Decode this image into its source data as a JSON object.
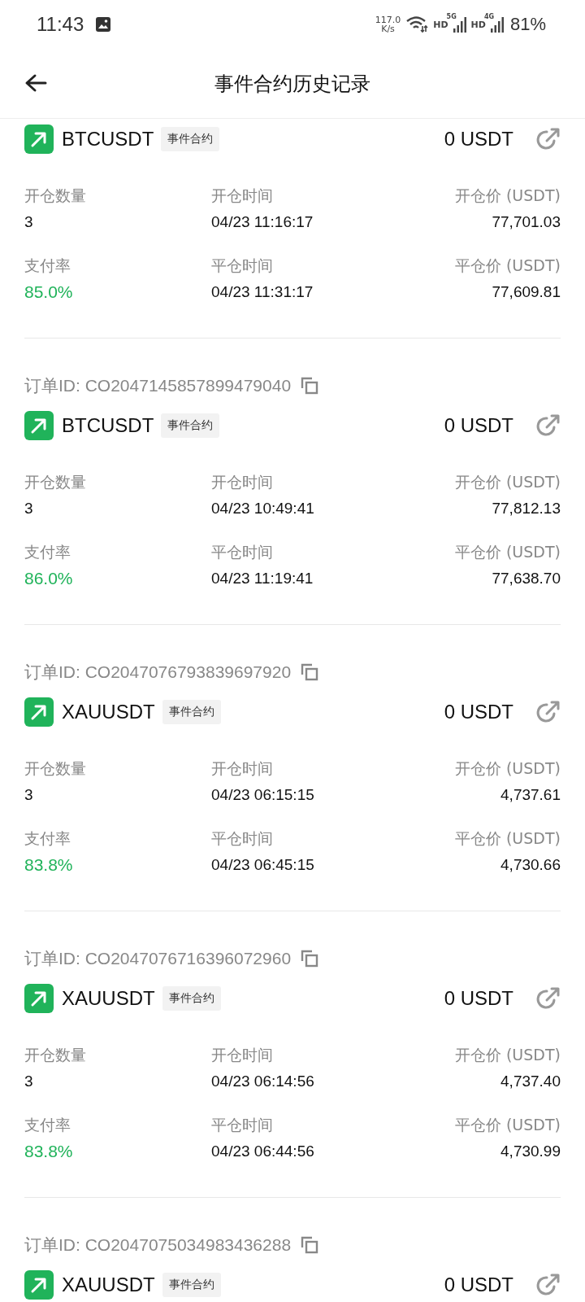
{
  "status_bar": {
    "time": "11:43",
    "speed": "117.0",
    "speed_unit": "K/s",
    "hd_1": "HD",
    "net_1": "5G",
    "hd_2": "HD",
    "net_2": "4G",
    "battery": "81%"
  },
  "header": {
    "title": "事件合约历史记录"
  },
  "orders": [
    {
      "symbol": "BTCUSDT",
      "tag": "事件合约",
      "pnl": "0 USDT",
      "details": [
        {
          "label": "开仓数量",
          "value": "3",
          "kind": "plain"
        },
        {
          "label": "开仓时间",
          "value": "04/23 11:16:17",
          "kind": "plain"
        },
        {
          "label": "开仓价 (USDT)",
          "value": "77,701.03",
          "kind": "plain"
        },
        {
          "label": "支付率",
          "value": "85.0%",
          "kind": "rate"
        },
        {
          "label": "平仓时间",
          "value": "04/23 11:31:17",
          "kind": "plain"
        },
        {
          "label": "平仓价 (USDT)",
          "value": "77,609.81",
          "kind": "plain"
        }
      ]
    },
    {
      "order_id": "订单ID: CO2047145857899479040",
      "symbol": "BTCUSDT",
      "tag": "事件合约",
      "pnl": "0 USDT",
      "details": [
        {
          "label": "开仓数量",
          "value": "3",
          "kind": "plain"
        },
        {
          "label": "开仓时间",
          "value": "04/23 10:49:41",
          "kind": "plain"
        },
        {
          "label": "开仓价 (USDT)",
          "value": "77,812.13",
          "kind": "plain"
        },
        {
          "label": "支付率",
          "value": "86.0%",
          "kind": "rate"
        },
        {
          "label": "平仓时间",
          "value": "04/23 11:19:41",
          "kind": "plain"
        },
        {
          "label": "平仓价 (USDT)",
          "value": "77,638.70",
          "kind": "plain"
        }
      ]
    },
    {
      "order_id": "订单ID: CO2047076793839697920",
      "symbol": "XAUUSDT",
      "tag": "事件合约",
      "pnl": "0 USDT",
      "details": [
        {
          "label": "开仓数量",
          "value": "3",
          "kind": "plain"
        },
        {
          "label": "开仓时间",
          "value": "04/23 06:15:15",
          "kind": "plain"
        },
        {
          "label": "开仓价 (USDT)",
          "value": "4,737.61",
          "kind": "plain"
        },
        {
          "label": "支付率",
          "value": "83.8%",
          "kind": "rate"
        },
        {
          "label": "平仓时间",
          "value": "04/23 06:45:15",
          "kind": "plain"
        },
        {
          "label": "平仓价 (USDT)",
          "value": "4,730.66",
          "kind": "plain"
        }
      ]
    },
    {
      "order_id": "订单ID: CO2047076716396072960",
      "symbol": "XAUUSDT",
      "tag": "事件合约",
      "pnl": "0 USDT",
      "details": [
        {
          "label": "开仓数量",
          "value": "3",
          "kind": "plain"
        },
        {
          "label": "开仓时间",
          "value": "04/23 06:14:56",
          "kind": "plain"
        },
        {
          "label": "开仓价 (USDT)",
          "value": "4,737.40",
          "kind": "plain"
        },
        {
          "label": "支付率",
          "value": "83.8%",
          "kind": "rate"
        },
        {
          "label": "平仓时间",
          "value": "04/23 06:44:56",
          "kind": "plain"
        },
        {
          "label": "平仓价 (USDT)",
          "value": "4,730.99",
          "kind": "plain"
        }
      ]
    },
    {
      "order_id": "订单ID: CO2047075034983436288",
      "symbol": "XAUUSDT",
      "tag": "事件合约",
      "pnl": "0 USDT"
    }
  ]
}
